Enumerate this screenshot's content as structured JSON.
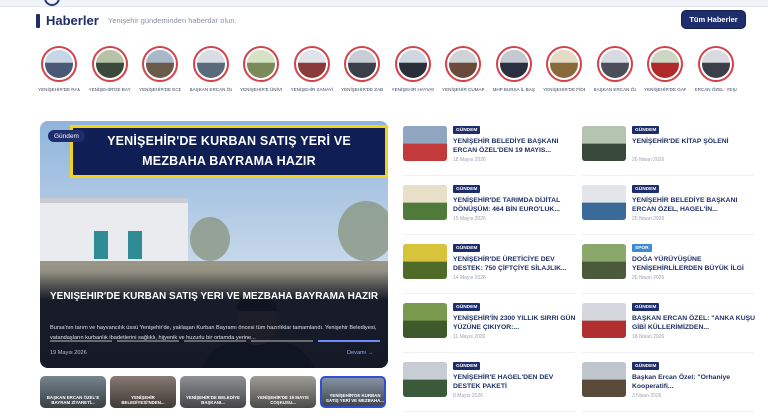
{
  "header": {
    "title": "Haberler",
    "subtitle": "Yenişehir gündeminden haberdar olun.",
    "all_button": "Tüm Haberler"
  },
  "stories": [
    {
      "caption": "YENİŞEHİR'DE RAMAZAN...",
      "colors": [
        "#c7d6e6",
        "#4a5a75"
      ]
    },
    {
      "caption": "YENİŞEHİR'DE BAYRAM...",
      "colors": [
        "#b7c3a8",
        "#3a4a3a"
      ]
    },
    {
      "caption": "YENİŞEHİR'DE ECDADA VEFA...",
      "colors": [
        "#a9b8c8",
        "#6a5a4a"
      ]
    },
    {
      "caption": "BAŞKAN ERCAN ÖZEL: \"SİZLER...",
      "colors": [
        "#d8dde4",
        "#5a6a7a"
      ]
    },
    {
      "caption": "YENİŞEHİR'E ÜNİVERSİTE...",
      "colors": [
        "#d6e2c6",
        "#7a8a5a"
      ]
    },
    {
      "caption": "YENİŞEHİR SANAYİ SİTESİ...",
      "colors": [
        "#e0e4ea",
        "#8a3a3a"
      ]
    },
    {
      "caption": "YENİŞEHİR'DE ZABITADAN...",
      "colors": [
        "#c8cdd4",
        "#3a3f4a"
      ]
    },
    {
      "caption": "YENİŞEHİR HAYVAN...",
      "colors": [
        "#cfd7e0",
        "#2a2f3a"
      ]
    },
    {
      "caption": "YENİŞEHİR CUMARTESİ...",
      "colors": [
        "#d0d2d6",
        "#6a4a3a"
      ]
    },
    {
      "caption": "MHP BURSA İL BAŞKANI...",
      "colors": [
        "#c4c8d0",
        "#2a3040"
      ]
    },
    {
      "caption": "YENİŞEHİR'DE FİDE FİYATLARI...",
      "colors": [
        "#e4dcc6",
        "#8a6a3a"
      ]
    },
    {
      "caption": "BAŞKAN ERCAN ÖZEL...",
      "colors": [
        "#d6dbe2",
        "#4a4f5a"
      ]
    },
    {
      "caption": "YENİŞEHİR'DE GARNİZON...",
      "colors": [
        "#cbd6c4",
        "#b02a2a"
      ]
    },
    {
      "caption": "ERCAN ÖZEL: YEŞAŞ YENİDE...",
      "colors": [
        "#d8dadf",
        "#3a3f4a"
      ]
    }
  ],
  "hero": {
    "tag": "Gündem",
    "banner_line1": "YENİŞEHİR'DE KURBAN SATIŞ YERİ VE",
    "banner_line2": "MEZBAHA BAYRAMA HAZIR",
    "title": "Yenişehir'de Kurban Satış Yeri ve Mezbaha Bayrama Hazır",
    "excerpt": "Bursa'nın tarım ve hayvancılık üssü Yenişehir'de, yaklaşan Kurban Bayramı öncesi tüm hazırlıklar tamamlandı. Yenişehir Belediyesi, vatandaşların kurbanlık ibadetlerini sağlıklı, hijyenik ve huzurlu bir ortamda yerine...",
    "date": "19 Mayıs 2026",
    "more": "Devamı →"
  },
  "thumbs": [
    {
      "caption": "BAŞKAN ERCAN ÖZEL'E BAYRAM ZİYARETİ...",
      "color": "#7d8a96"
    },
    {
      "caption": "YENİŞEHİR BELEDİYESİ'NDEN...",
      "color": "#8e7f78"
    },
    {
      "caption": "YENİŞEHİR'DE BELEDİYE BAŞKANI...",
      "color": "#98999e"
    },
    {
      "caption": "YENİŞEHİR'DE 19 MAYIS COŞKUSU...",
      "color": "#a7a59e"
    },
    {
      "caption": "YENİŞEHİR'DE KURBAN SATIŞ YERİ VE MEZBAHA...",
      "color": "#8c9aab"
    }
  ],
  "news_left": [
    {
      "badge": "GÜNDEM",
      "title": "YENİŞEHİR BELEDİYE BAŞKANI ERCAN ÖZEL'DEN 19 MAYIS...",
      "date": "18 Mayıs 2026",
      "colors": [
        "#8fa5c0",
        "#c33a3a"
      ]
    },
    {
      "badge": "GÜNDEM",
      "title": "YENİŞEHİR'DE TARIMDA DİJİTAL DÖNÜŞÜM: 464 BİN EURO'LUK...",
      "date": "15 Mayıs 2026",
      "colors": [
        "#e8e0c8",
        "#4f7a3a"
      ]
    },
    {
      "badge": "GÜNDEM",
      "title": "YENİŞEHİR'DE ÜRETİCİYE DEV DESTEK: 750 ÇİFTÇİYE SİLAJLIK...",
      "date": "14 Mayıs 2026",
      "colors": [
        "#d8c43a",
        "#4e6b2a"
      ]
    },
    {
      "badge": "GÜNDEM",
      "title": "YENİŞEHİR'İN 2300 YILLIK SIRRI GÜN YÜZÜNE ÇIKIYOR:...",
      "date": "11 Mayıs 2026",
      "colors": [
        "#7a9a4e",
        "#3e5a2a"
      ]
    },
    {
      "badge": "GÜNDEM",
      "title": "YENİŞEHİR'E HAGEL'DEN DEV DESTEK PAKETİ",
      "date": "8 Mayıs 2026",
      "colors": [
        "#c8ccd4",
        "#3a5a3a"
      ]
    }
  ],
  "news_right": [
    {
      "badge": "GÜNDEM",
      "title": "YENİŞEHİR'DE KİTAP ŞÖLENİ",
      "date": "26 Nisan 2026",
      "colors": [
        "#b4c4b0",
        "#3a4a3a"
      ],
      "spor": false,
      "mixed": false
    },
    {
      "badge": "GÜNDEM",
      "title": "YENİŞEHİR BELEDİYE BAŞKANI ERCAN ÖZEL, HAGEL'İN...",
      "date": "25 Nisan 2026",
      "colors": [
        "#e2e6ea",
        "#3a6a9a"
      ],
      "spor": false,
      "mixed": false
    },
    {
      "badge": "SPOR",
      "title": "DOĞA YÜRÜYÜŞÜNE YENİŞEHİRLİLERDEN BÜYÜK İLGİ",
      "date": "26 Nisan 2026",
      "colors": [
        "#8aa86a",
        "#4a5a3a"
      ],
      "spor": true,
      "mixed": false
    },
    {
      "badge": "GÜNDEM",
      "title": "BAŞKAN ERCAN ÖZEL: \"ANKA KUŞU GİBİ KÜLLERİMİZDEN...",
      "date": "18 Nisan 2026",
      "colors": [
        "#d4d8de",
        "#b03030"
      ],
      "spor": false,
      "mixed": false
    },
    {
      "badge": "GÜNDEM",
      "title": "Başkan Ercan Özel: \"Orhaniye Kooperatifi...",
      "date": "3 Nisan 2026",
      "colors": [
        "#c0c6ce",
        "#5a4a3a"
      ],
      "spor": false,
      "mixed": true
    }
  ],
  "accent_color": "#1e2d6b",
  "story_ring_color": "#d2424a"
}
